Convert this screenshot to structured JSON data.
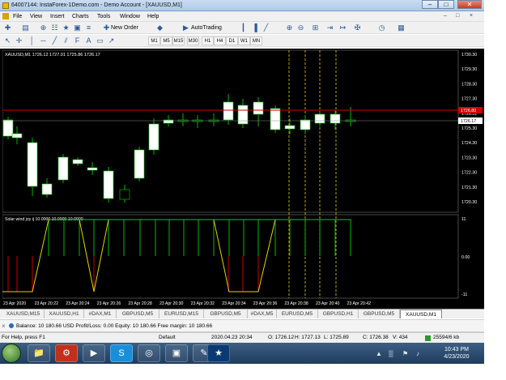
{
  "window": {
    "title": "64007144: InstaForex-1Demo.com - Demo Account - [XAUUSD,M1]",
    "minimize": "–",
    "maximize": "□",
    "close": "✕"
  },
  "menu": {
    "items": [
      "File",
      "View",
      "Insert",
      "Charts",
      "Tools",
      "Window",
      "Help"
    ],
    "right_minimize": "–",
    "right_restore": "□",
    "right_close": "×"
  },
  "toolbar": {
    "new_order": "New Order",
    "autotrading": "AutoTrading",
    "timeframes": [
      "M1",
      "M5",
      "M15",
      "M30",
      "H1",
      "H4",
      "D1",
      "W1",
      "MN"
    ]
  },
  "chart": {
    "header": "XAUUSD,M1  1726.12 1727.01 1725.86 1726.17",
    "indicator_label": "Solar wind joy ij 10.0000 10.0000 10.0000",
    "price_labels": [
      "1730.30",
      "1729.30",
      "1728.30",
      "1727.30",
      "1726.31",
      "1725.30",
      "1724.30",
      "1723.30",
      "1722.30",
      "1721.30",
      "1720.30"
    ],
    "red_line_label": "1726.80",
    "current_label": "1726.17",
    "indicator_scale": [
      "11",
      "0.00",
      "-11"
    ],
    "time_labels": [
      "23 Apr 2020",
      "23 Apr 20:22",
      "23 Apr 20:24",
      "23 Apr 20:26",
      "23 Apr 20:28",
      "23 Apr 20:30",
      "23 Apr 20:32",
      "23 Apr 20:34",
      "23 Apr 20:36",
      "23 Apr 20:38",
      "23 Apr 20:40",
      "23 Apr 20:42"
    ],
    "colors": {
      "background": "#000000",
      "bull": "#ffffff",
      "bear": "#000000",
      "wick": "#00c800",
      "red_line": "#d00000",
      "current_line": "#8c8c8c",
      "vlines": "#e6d200",
      "ind_green": "#00d000",
      "ind_red": "#e00000",
      "ind_yellow": "#e6d200"
    }
  },
  "tabs": [
    "XAUUSD,M15",
    "XAUUSD,H1",
    "#DAX,M1",
    "GBPUSD,M5",
    "EURUSD,M15",
    "GBPUSD,M5",
    "#DAX,M5",
    "EURUSD,M5",
    "GBPUSD,H1",
    "GBPUSD,M5",
    "XAUUSD,M1"
  ],
  "info": {
    "text": "Balance: 10 180.66 USD  Profit/Loss: 0.00  Equity: 10 180.66  Free margin: 10 180.66"
  },
  "status": {
    "help": "For Help, press F1",
    "profile": "Default",
    "datetime": "2020.04.23 20:34",
    "open": "O: 1726.12",
    "high": "H: 1727.13",
    "low": "L: 1725.89",
    "close": "C: 1726.38",
    "volume": "V: 434",
    "traffic": "25594/6 kb"
  },
  "taskbar": {
    "time": "10:43 PM",
    "date": "4/23/2020"
  }
}
